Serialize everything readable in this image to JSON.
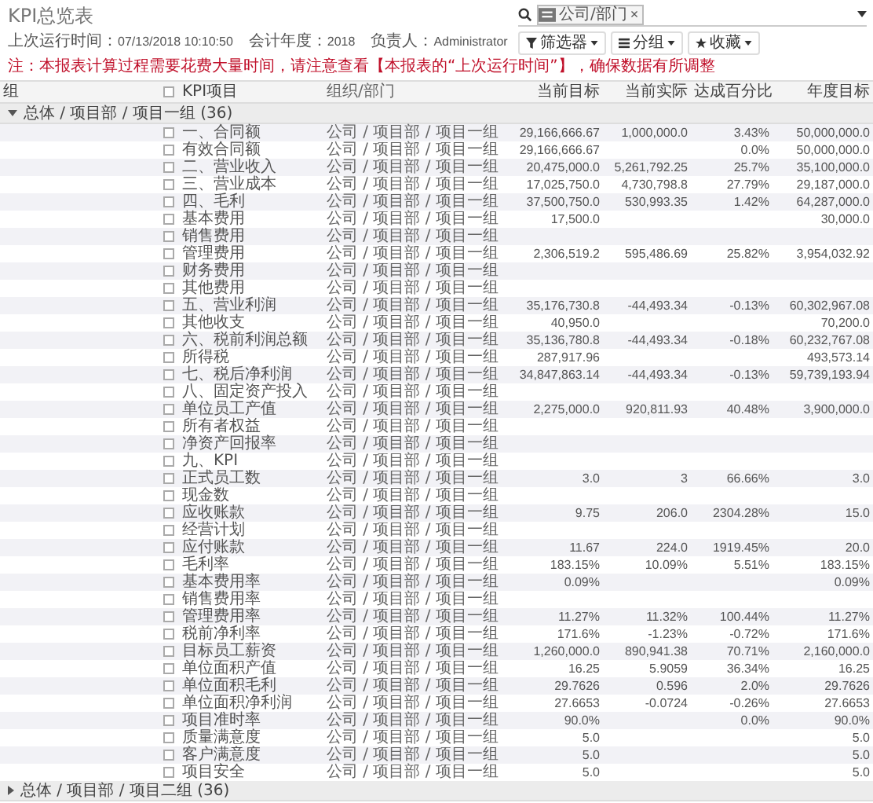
{
  "report": {
    "title": "KPI总览表",
    "last_run_label": "上次运行时间：",
    "last_run": "07/13/2018 10:10:50",
    "fiscal_year_label": "会计年度：",
    "fiscal_year": "2018",
    "owner_label": "负责人：",
    "owner": "Administrator",
    "note": "注：本报表计算过程需要花费大量时间，请注意查看【本报表的“上次运行时间”】，确保数据有所调整"
  },
  "search": {
    "facet": "公司/部门",
    "facet_remove": "×"
  },
  "buttons": [
    {
      "kind": "filter",
      "label": "筛选器"
    },
    {
      "kind": "group",
      "label": "分组"
    },
    {
      "kind": "favorite",
      "label": "收藏"
    }
  ],
  "table": {
    "select_all_checked": false,
    "columns": [
      "组",
      "KPI项目",
      "组织/部门",
      "当前目标",
      "当前实际",
      "达成百分比",
      "年度目标"
    ],
    "groups": [
      {
        "label": "总体 / 项目部 / 项目一组 (36)",
        "expanded": true,
        "rows": [
          {
            "kpi": "一、合同额",
            "org": "公司 / 项目部 / 项目一组",
            "target": "29,166,666.67",
            "actual": "1,000,000.0",
            "pct": "3.43%",
            "annual": "50,000,000.0",
            "checked": false
          },
          {
            "kpi": "有效合同额",
            "org": "公司 / 项目部 / 项目一组",
            "target": "29,166,666.67",
            "pct": "0.0%",
            "annual": "50,000,000.0",
            "checked": false
          },
          {
            "kpi": "二、营业收入",
            "org": "公司 / 项目部 / 项目一组",
            "target": "20,475,000.0",
            "actual": "5,261,792.25",
            "pct": "25.7%",
            "annual": "35,100,000.0",
            "checked": false
          },
          {
            "kpi": "三、营业成本",
            "org": "公司 / 项目部 / 项目一组",
            "target": "17,025,750.0",
            "actual": "4,730,798.8",
            "pct": "27.79%",
            "annual": "29,187,000.0",
            "checked": false
          },
          {
            "kpi": "四、毛利",
            "org": "公司 / 项目部 / 项目一组",
            "target": "37,500,750.0",
            "actual": "530,993.35",
            "pct": "1.42%",
            "annual": "64,287,000.0",
            "checked": false
          },
          {
            "kpi": "基本费用",
            "org": "公司 / 项目部 / 项目一组",
            "target": "17,500.0",
            "annual": "30,000.0",
            "checked": false
          },
          {
            "kpi": "销售费用",
            "org": "公司 / 项目部 / 项目一组",
            "checked": false
          },
          {
            "kpi": "管理费用",
            "org": "公司 / 项目部 / 项目一组",
            "target": "2,306,519.2",
            "actual": "595,486.69",
            "pct": "25.82%",
            "annual": "3,954,032.92",
            "checked": false
          },
          {
            "kpi": "财务费用",
            "org": "公司 / 项目部 / 项目一组",
            "checked": false
          },
          {
            "kpi": "其他费用",
            "org": "公司 / 项目部 / 项目一组",
            "checked": false
          },
          {
            "kpi": "五、营业利润",
            "org": "公司 / 项目部 / 项目一组",
            "target": "35,176,730.8",
            "actual": "-44,493.34",
            "pct": "-0.13%",
            "annual": "60,302,967.08",
            "checked": false
          },
          {
            "kpi": "其他收支",
            "org": "公司 / 项目部 / 项目一组",
            "target": "40,950.0",
            "annual": "70,200.0",
            "checked": false
          },
          {
            "kpi": "六、税前利润总额",
            "org": "公司 / 项目部 / 项目一组",
            "target": "35,136,780.8",
            "actual": "-44,493.34",
            "pct": "-0.18%",
            "annual": "60,232,767.08",
            "checked": false
          },
          {
            "kpi": "所得税",
            "org": "公司 / 项目部 / 项目一组",
            "target": "287,917.96",
            "annual": "493,573.14",
            "checked": false
          },
          {
            "kpi": "七、税后净利润",
            "org": "公司 / 项目部 / 项目一组",
            "target": "34,847,863.14",
            "actual": "-44,493.34",
            "pct": "-0.13%",
            "annual": "59,739,193.94",
            "checked": false
          },
          {
            "kpi": "八、固定资产投入",
            "org": "公司 / 项目部 / 项目一组",
            "checked": false
          },
          {
            "kpi": "单位员工产值",
            "org": "公司 / 项目部 / 项目一组",
            "target": "2,275,000.0",
            "actual": "920,811.93",
            "pct": "40.48%",
            "annual": "3,900,000.0",
            "checked": false
          },
          {
            "kpi": "所有者权益",
            "org": "公司 / 项目部 / 项目一组",
            "checked": false
          },
          {
            "kpi": "净资产回报率",
            "org": "公司 / 项目部 / 项目一组",
            "checked": false
          },
          {
            "kpi": "九、KPI",
            "org": "公司 / 项目部 / 项目一组",
            "checked": false
          },
          {
            "kpi": "正式员工数",
            "org": "公司 / 项目部 / 项目一组",
            "target": "3.0",
            "actual": "3",
            "pct": "66.66%",
            "annual": "3.0",
            "checked": false
          },
          {
            "kpi": "现金数",
            "org": "公司 / 项目部 / 项目一组",
            "checked": false
          },
          {
            "kpi": "应收账款",
            "org": "公司 / 项目部 / 项目一组",
            "target": "9.75",
            "actual": "206.0",
            "pct": "2304.28%",
            "annual": "15.0",
            "checked": false
          },
          {
            "kpi": "经营计划",
            "org": "公司 / 项目部 / 项目一组",
            "checked": false
          },
          {
            "kpi": "应付账款",
            "org": "公司 / 项目部 / 项目一组",
            "target": "11.67",
            "actual": "224.0",
            "pct": "1919.45%",
            "annual": "20.0",
            "checked": false
          },
          {
            "kpi": "毛利率",
            "org": "公司 / 项目部 / 项目一组",
            "target": "183.15%",
            "actual": "10.09%",
            "pct": "5.51%",
            "annual": "183.15%",
            "checked": false
          },
          {
            "kpi": "基本费用率",
            "org": "公司 / 项目部 / 项目一组",
            "target": "0.09%",
            "annual": "0.09%",
            "checked": false
          },
          {
            "kpi": "销售费用率",
            "org": "公司 / 项目部 / 项目一组",
            "checked": false
          },
          {
            "kpi": "管理费用率",
            "org": "公司 / 项目部 / 项目一组",
            "target": "11.27%",
            "actual": "11.32%",
            "pct": "100.44%",
            "annual": "11.27%",
            "checked": false
          },
          {
            "kpi": "税前净利率",
            "org": "公司 / 项目部 / 项目一组",
            "target": "171.6%",
            "actual": "-1.23%",
            "pct": "-0.72%",
            "annual": "171.6%",
            "checked": false
          },
          {
            "kpi": "目标员工薪资",
            "org": "公司 / 项目部 / 项目一组",
            "target": "1,260,000.0",
            "actual": "890,941.38",
            "pct": "70.71%",
            "annual": "2,160,000.0",
            "checked": false
          },
          {
            "kpi": "单位面积产值",
            "org": "公司 / 项目部 / 项目一组",
            "target": "16.25",
            "actual": "5.9059",
            "pct": "36.34%",
            "annual": "16.25",
            "checked": false
          },
          {
            "kpi": "单位面积毛利",
            "org": "公司 / 项目部 / 项目一组",
            "target": "29.7626",
            "actual": "0.596",
            "pct": "2.0%",
            "annual": "29.7626",
            "checked": false
          },
          {
            "kpi": "单位面积净利润",
            "org": "公司 / 项目部 / 项目一组",
            "target": "27.6653",
            "actual": "-0.0724",
            "pct": "-0.26%",
            "annual": "27.6653",
            "checked": false
          },
          {
            "kpi": "项目准时率",
            "org": "公司 / 项目部 / 项目一组",
            "target": "90.0%",
            "pct": "0.0%",
            "annual": "90.0%",
            "checked": false
          },
          {
            "kpi": "质量满意度",
            "org": "公司 / 项目部 / 项目一组",
            "target": "5.0",
            "annual": "5.0",
            "checked": false
          },
          {
            "kpi": "客户满意度",
            "org": "公司 / 项目部 / 项目一组",
            "target": "5.0",
            "annual": "5.0",
            "checked": false
          },
          {
            "kpi": "项目安全",
            "org": "公司 / 项目部 / 项目一组",
            "target": "5.0",
            "annual": "5.0",
            "checked": false
          }
        ]
      },
      {
        "label": "总体 / 项目部 / 项目二组 (36)",
        "expanded": false
      }
    ]
  }
}
